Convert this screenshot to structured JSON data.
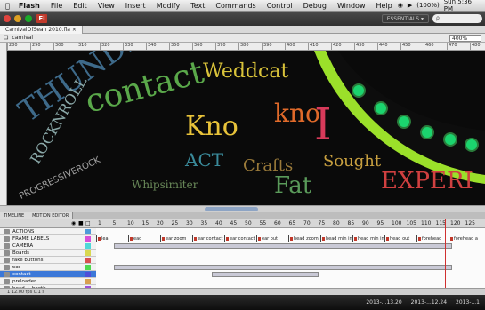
{
  "menubar": {
    "app": "Flash",
    "items": [
      "File",
      "Edit",
      "View",
      "Insert",
      "Modify",
      "Text",
      "Commands",
      "Control",
      "Debug",
      "Window",
      "Help"
    ],
    "battery": "(100%)",
    "clock": "Sun 5:36 PM"
  },
  "window": {
    "workspace": "ESSENTIALS ▾",
    "search_placeholder": "ρ"
  },
  "document": {
    "tab": "CarnivalOfSean 2010.fla ×",
    "scene": "carnival",
    "zoom": "400%"
  },
  "ruler_ticks": [
    "280",
    "290",
    "300",
    "310",
    "320",
    "330",
    "340",
    "350",
    "360",
    "370",
    "380",
    "390",
    "400",
    "410",
    "420",
    "430",
    "440",
    "450",
    "460",
    "470",
    "480",
    "490",
    "500",
    "510",
    "520",
    "530"
  ],
  "timeline": {
    "tabs": [
      "TIMELINE",
      "MOTION EDITOR"
    ],
    "frame_numbers": [
      "1",
      "5",
      "10",
      "15",
      "20",
      "25",
      "30",
      "35",
      "40",
      "45",
      "50",
      "55",
      "60",
      "65",
      "70",
      "75",
      "80",
      "85",
      "90",
      "95",
      "100",
      "105",
      "110",
      "115",
      "120",
      "125"
    ],
    "layers": [
      {
        "name": "ACTIONS",
        "color": "#4f9ad8"
      },
      {
        "name": "FRAME LABELS",
        "color": "#d84fd8"
      },
      {
        "name": "CAMERA",
        "color": "#4fd8d8"
      },
      {
        "name": "Boards",
        "color": "#d8d84f"
      },
      {
        "name": "fake buttons",
        "color": "#d84f4f"
      },
      {
        "name": "ear",
        "color": "#4fd84f"
      },
      {
        "name": "contact",
        "color": "#4f4fd8"
      },
      {
        "name": "preloader",
        "color": "#d8a04f"
      },
      {
        "name": "head + booth",
        "color": "#a04fd8"
      }
    ],
    "frame_labels": [
      "lea",
      "ead",
      "ear zoom",
      "ear contact",
      "ear contact",
      "ear out",
      "head zoom",
      "head min in",
      "head min in",
      "head out",
      "forehead",
      "forehead a"
    ],
    "footer": "1   12.00 fps   0.1 s"
  },
  "stage_words": [
    "THUNDER",
    "contact",
    "Weddcat",
    "Kno",
    "kno",
    "I",
    "Fat",
    "ACT",
    "Crafts",
    "Sought",
    "EXPERI",
    "ROCKNROLL",
    "PROGRESSIVEROCK",
    "Whipsimiter"
  ],
  "dock": {
    "items": [
      "2013-...13.20",
      "2013-...12.24",
      "2013-...1"
    ]
  }
}
